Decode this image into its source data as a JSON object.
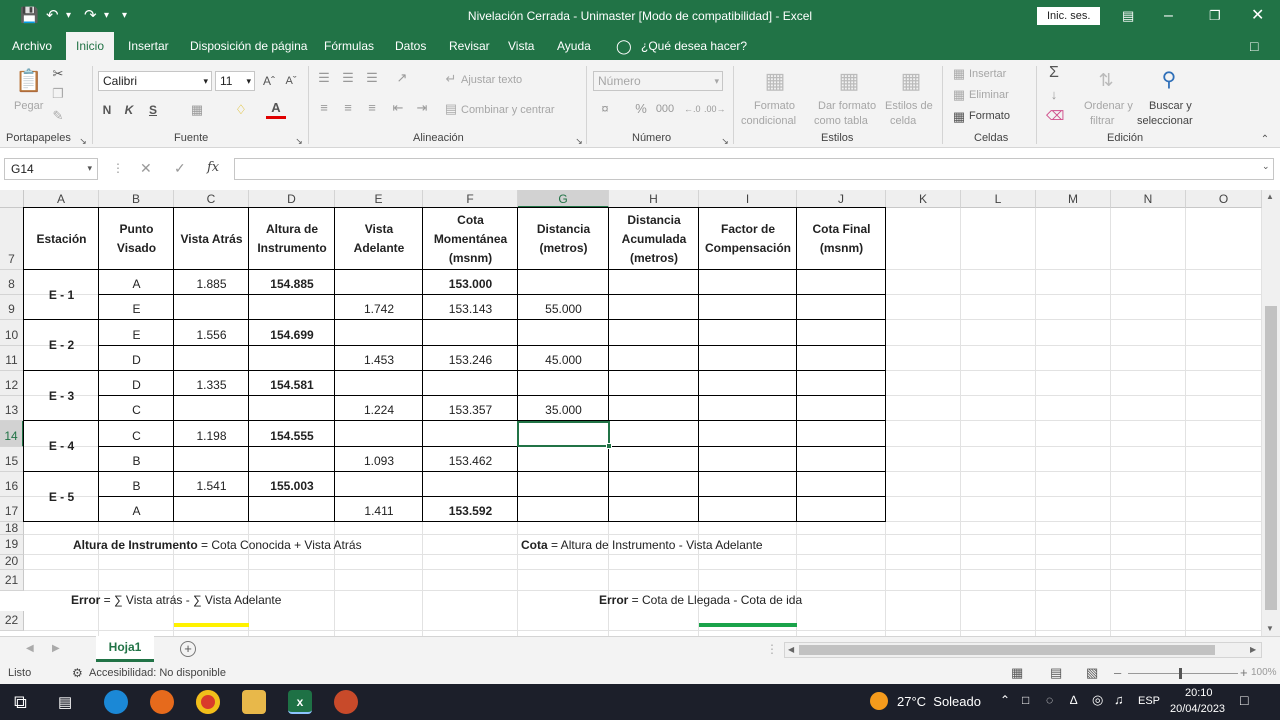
{
  "app": {
    "title": "Nivelación Cerrada - Unimaster  [Modo de compatibilidad]  -  Excel",
    "signin": "Inic. ses.",
    "accent": "#217346"
  },
  "tabs": [
    "Archivo",
    "Inicio",
    "Insertar",
    "Disposición de página",
    "Fórmulas",
    "Datos",
    "Revisar",
    "Vista",
    "Ayuda",
    "¿Qué desea hacer?"
  ],
  "ribbon": {
    "paste": "Pegar",
    "font_name": "Calibri",
    "font_size": "11",
    "bold": "N",
    "italic": "K",
    "underline": "S",
    "wrap": "Ajustar texto",
    "merge": "Combinar y centrar",
    "number_format": "Número",
    "cond_fmt_1": "Formato",
    "cond_fmt_2": "condicional",
    "table_fmt_1": "Dar formato",
    "table_fmt_2": "como tabla",
    "cell_styles_1": "Estilos de",
    "cell_styles_2": "celda",
    "insert": "Insertar",
    "delete": "Eliminar",
    "format": "Formato",
    "sort_1": "Ordenar y",
    "sort_2": "filtrar",
    "find_1": "Buscar y",
    "find_2": "seleccionar",
    "groups": [
      "Portapapeles",
      "Fuente",
      "Alineación",
      "Número",
      "Estilos",
      "Celdas",
      "Edición"
    ]
  },
  "formula_bar": {
    "name_box": "G14",
    "fx": "fx",
    "value": ""
  },
  "columns": [
    "A",
    "B",
    "C",
    "D",
    "E",
    "F",
    "G",
    "H",
    "I",
    "J",
    "K",
    "L",
    "M",
    "N",
    "O"
  ],
  "rows": [
    "7",
    "8",
    "9",
    "10",
    "11",
    "12",
    "13",
    "14",
    "15",
    "16",
    "17",
    "18",
    "19",
    "20",
    "21",
    "22"
  ],
  "headers": {
    "A": "Estación",
    "B": "Punto Visado",
    "C": "Vista Atrás",
    "D": "Altura de Instrumento",
    "E": "Vista Adelante",
    "F": "Cota Momentánea (msnm)",
    "G": "Distancia (metros)",
    "H": "Distancia Acumulada (metros)",
    "I": "Factor de Compensación",
    "J": "Cota Final (msnm)"
  },
  "stations": [
    "E - 1",
    "E - 2",
    "E - 3",
    "E - 4",
    "E - 5"
  ],
  "points": [
    "A",
    "E",
    "E",
    "D",
    "D",
    "C",
    "C",
    "B",
    "B",
    "A"
  ],
  "vista_atras": [
    "1.885",
    "",
    "1.556",
    "",
    "1.335",
    "",
    "1.198",
    "",
    "1.541",
    ""
  ],
  "altura": [
    "154.885",
    "",
    "154.699",
    "",
    "154.581",
    "",
    "154.555",
    "",
    "155.003",
    ""
  ],
  "vista_adelante": [
    "",
    "1.742",
    "",
    "1.453",
    "",
    "1.224",
    "",
    "1.093",
    "",
    "1.411"
  ],
  "cota": [
    "153.000",
    "153.143",
    "",
    "153.246",
    "",
    "153.357",
    "",
    "153.462",
    "",
    "153.592"
  ],
  "distancia": [
    "",
    "55.000",
    "",
    "45.000",
    "",
    "35.000",
    "",
    "",
    "",
    ""
  ],
  "notes": {
    "f1_bold": "Altura de Instrumento",
    "f1_rest": " = Cota Conocida + Vista Atrás",
    "f2_bold": "Cota",
    "f2_rest": " = Altura de Instrumento - Vista Adelante",
    "f3_bold": "Error",
    "f3_rest": " = ∑ Vista atrás - ∑ Vista Adelante",
    "f4_bold": "Error",
    "f4_rest": " = Cota de Llegada - Cota de ida"
  },
  "sheet": {
    "tab": "Hoja1"
  },
  "status": {
    "ready": "Listo",
    "accessibility": "Accesibilidad: No disponible",
    "zoom": "100%"
  },
  "taskbar": {
    "weather": "27°C  Soleado",
    "lang": "ESP",
    "time": "20:10",
    "date": "20/04/2023"
  }
}
